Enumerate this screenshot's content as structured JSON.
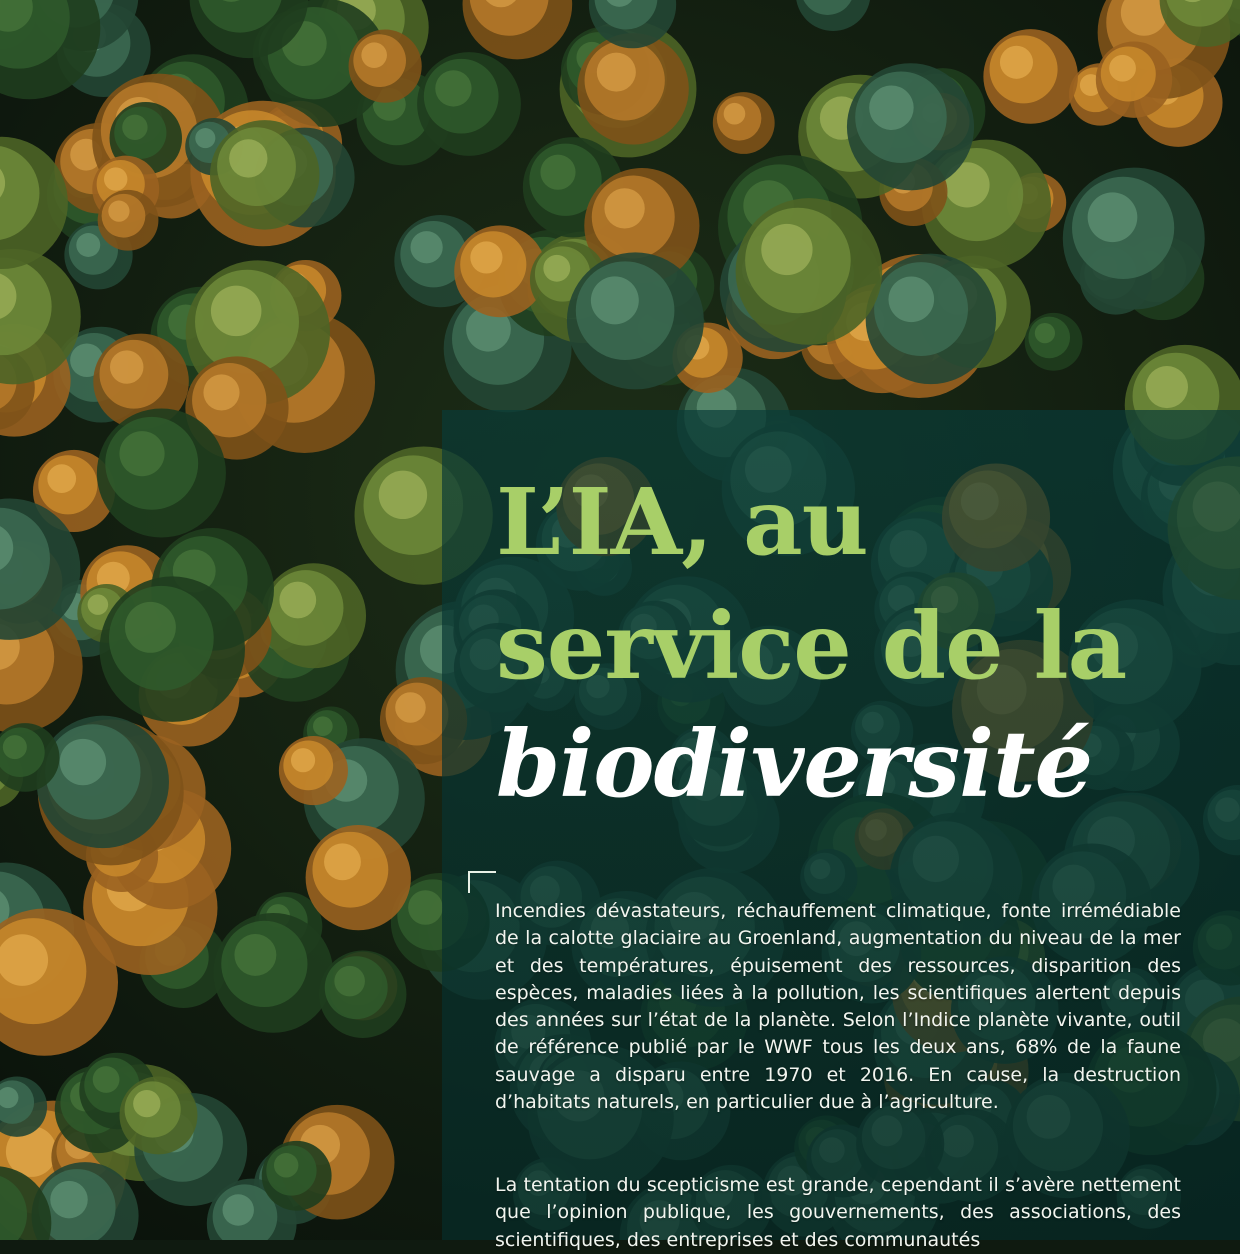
{
  "article": {
    "title_line_1": "L’IA, au",
    "title_line_2": "service de la",
    "title_line_3": "biodiversité",
    "paragraphs": [
      "Incendies dévastateurs, réchauffement climatique, fonte irrémédiable de la calotte glaciaire au Groenland, augmentation du niveau de la mer et des températures, épuisement des ressources, disparition des espèces, maladies liées à la pollution, les scientifiques alertent depuis des années sur l’état de la planète. Selon l’Indice planète vivante, outil de référence publié par le WWF tous les deux ans, 68% de la faune sauvage a disparu entre 1970 et 2016. En cause, la destruction d’habitats naturels, en particulier due à l’agriculture.",
      "La tentation du scepticisme est grande, cependant il s’avère nettement que l’opinion publique, les gouvernements, des associations, des scientifiques, des entreprises et des communautés"
    ]
  },
  "colors": {
    "title_accent": "#a8cf68",
    "title_emphasis": "#ffffff",
    "panel_overlay": "#08302e",
    "body_text": "#f2f5ef"
  },
  "background_image": "aerial-forest-canopy"
}
